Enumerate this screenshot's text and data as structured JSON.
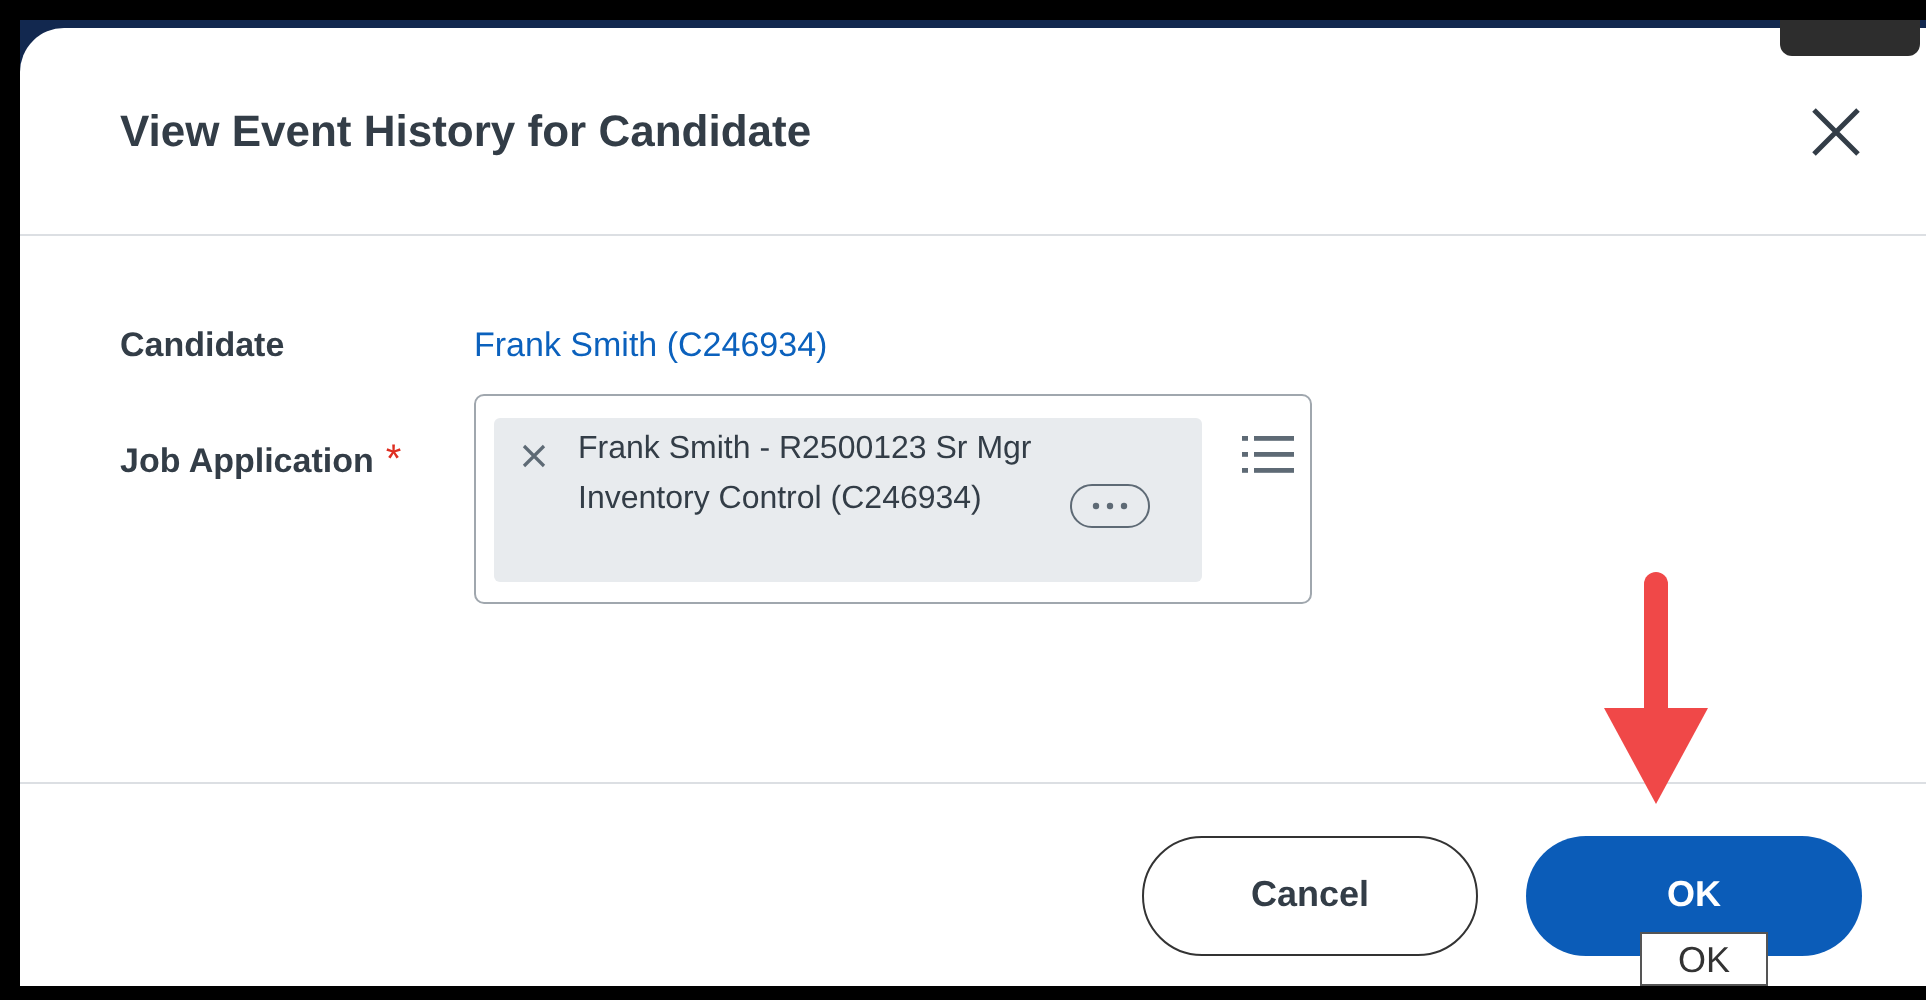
{
  "dialog": {
    "title": "View Event History for Candidate"
  },
  "fields": [
    {
      "label": "Candidate",
      "kind": "link",
      "value": "Frank Smith (C246934)"
    },
    {
      "label": "Job Application",
      "required_mark": "*",
      "kind": "multiselect",
      "chips": [
        {
          "text": "Frank Smith - R2500123 Sr Mgr Inventory Control (C246934)"
        }
      ]
    }
  ],
  "buttons": [
    {
      "label": "Cancel",
      "kind": "secondary"
    },
    {
      "label": "OK",
      "kind": "primary"
    }
  ],
  "tooltip": {
    "text": "OK"
  }
}
